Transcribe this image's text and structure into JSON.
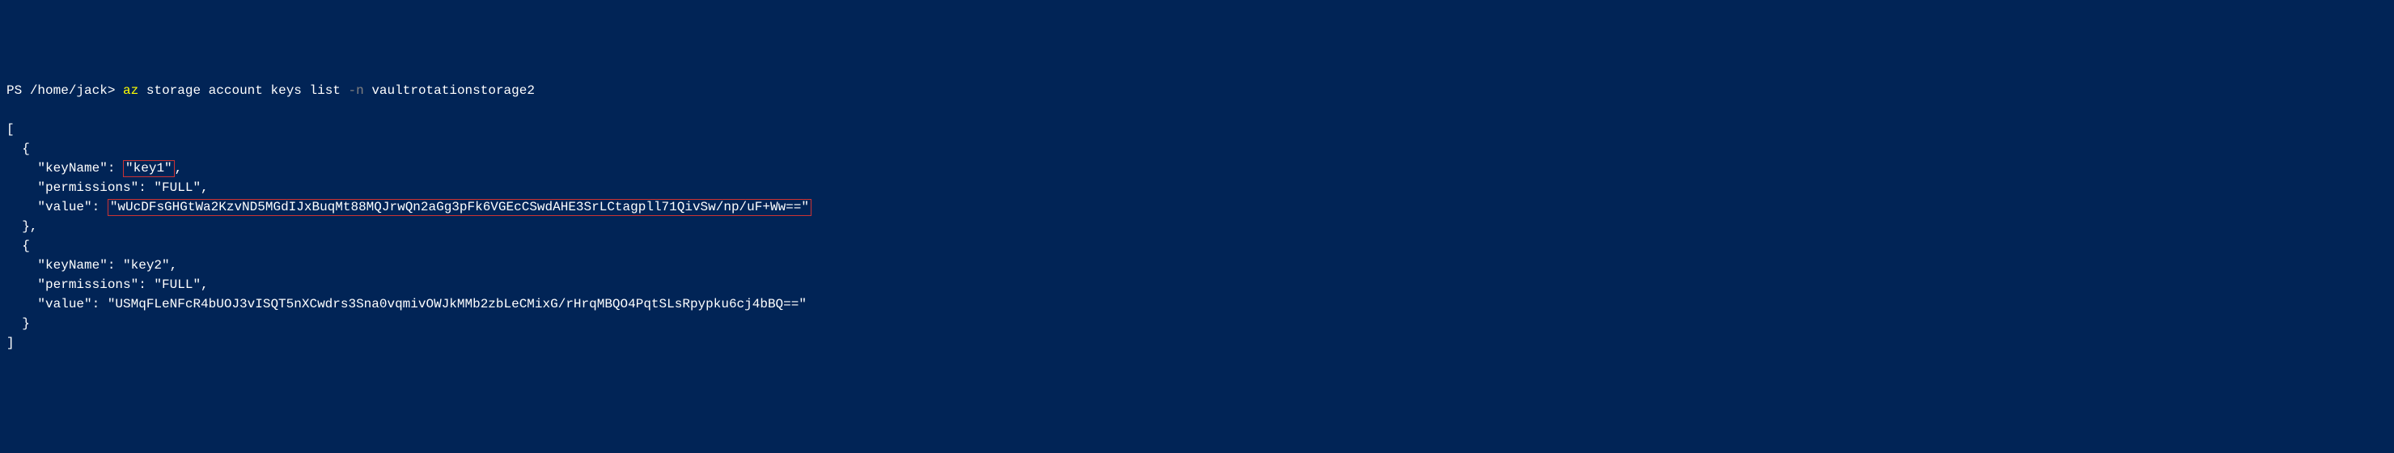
{
  "prompt": {
    "ps": "PS",
    "path": "/home/jack",
    "gt": ">",
    "cmd_az": "az",
    "cmd_args": "storage account keys list",
    "cmd_flag": "-n",
    "cmd_value": "vaultrotationstorage2"
  },
  "output": {
    "bracket_open": "[",
    "brace_open": "  {",
    "key1_name_label": "    \"keyName\": ",
    "key1_name_value": "\"key1\"",
    "key1_name_comma": ",",
    "key1_permissions": "    \"permissions\": \"FULL\",",
    "key1_value_label": "    \"value\": ",
    "key1_value_value": "\"wUcDFsGHGtWa2KzvND5MGdIJxBuqMt88MQJrwQn2aGg3pFk6VGEcCSwdAHE3SrLCtagpll71QivSw/np/uF+Ww==\"",
    "brace_close1": "  },",
    "brace_open2": "  {",
    "key2_name": "    \"keyName\": \"key2\",",
    "key2_permissions": "    \"permissions\": \"FULL\",",
    "key2_value": "    \"value\": \"USMqFLeNFcR4bUOJ3vISQT5nXCwdrs3Sna0vqmivOWJkMMb2zbLeCMixG/rHrqMBQO4PqtSLsRpypku6cj4bBQ==\"",
    "brace_close2": "  }",
    "bracket_close": "]"
  }
}
